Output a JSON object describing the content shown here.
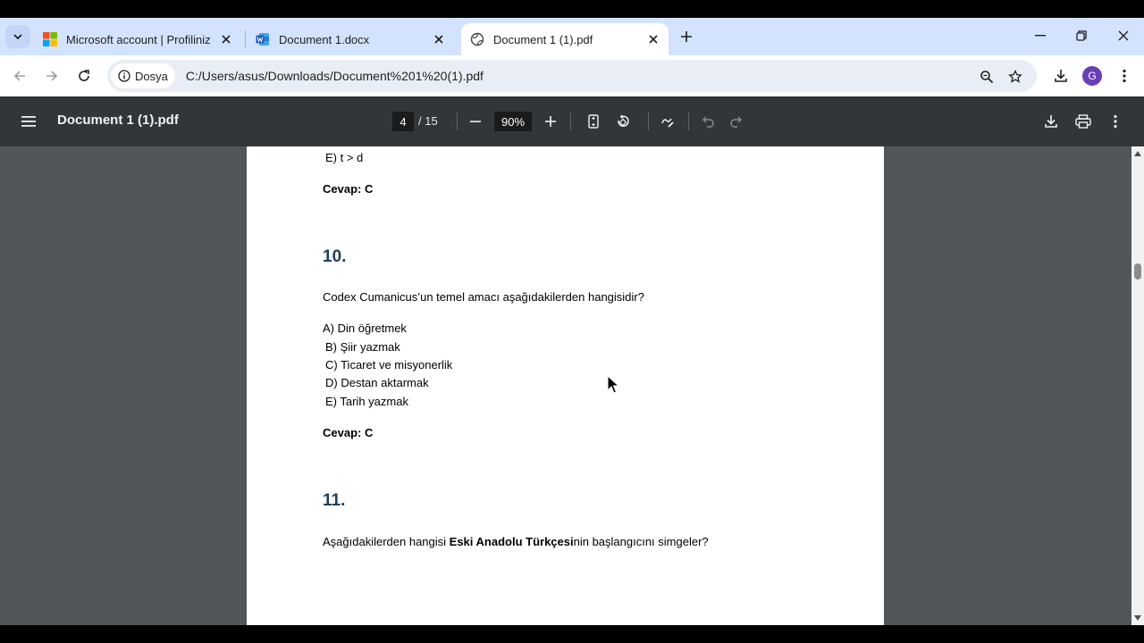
{
  "browser": {
    "tabs": [
      {
        "title": "Microsoft account | Profiliniz",
        "icon": "microsoft-logo-icon"
      },
      {
        "title": "Document 1.docx",
        "icon": "word-icon"
      },
      {
        "title": "Document 1 (1).pdf",
        "icon": "globe-icon",
        "active": true
      }
    ],
    "site_chip": "Dosya",
    "url": "C:/Users/asus/Downloads/Document%201%20(1).pdf",
    "profile_initial": "G"
  },
  "pdf_toolbar": {
    "doc_title": "Document 1 (1).pdf",
    "current_page": "4",
    "total_pages": "/ 15",
    "zoom": "90%"
  },
  "document": {
    "prev_option_e": "E) t > d",
    "prev_answer": "Cevap: C",
    "q10": {
      "number": "10.",
      "question": "Codex Cumanicus’un temel amacı aşağıdakilerden hangisidir?",
      "options": [
        "A) Din öğretmek",
        "B) Şiir yazmak",
        "C) Ticaret ve misyonerlik",
        "D) Destan aktarmak",
        "E) Tarih yazmak"
      ],
      "answer": "Cevap: C"
    },
    "q11": {
      "number": "11.",
      "question_prefix": "Aşağıdakilerden hangisi ",
      "question_bold": "Eski Anadolu Türkçesi",
      "question_suffix": "nin başlangıcını simgeler?"
    }
  },
  "colors": {
    "tabstrip": "#d3e3fd",
    "pdf_toolbar": "#323639",
    "viewer_bg": "#525659",
    "question_number": "#1c3f60"
  }
}
